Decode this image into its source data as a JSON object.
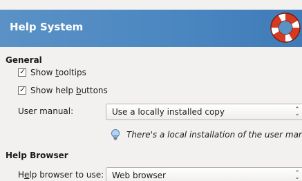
{
  "header": {
    "title": "Help System"
  },
  "general": {
    "heading": "General",
    "show_tooltips": {
      "label_pre": "Show ",
      "label_ul": "t",
      "label_post": "ooltips",
      "checked": true
    },
    "show_help_buttons": {
      "label_pre": "Show help ",
      "label_ul": "b",
      "label_post": "uttons",
      "checked": true
    },
    "user_manual": {
      "label": "User manual:",
      "value": "Use a locally installed copy",
      "info": "There's a local installation of the user manual."
    }
  },
  "help_browser": {
    "heading": "Help Browser",
    "browser_to_use": {
      "label_pre": "H",
      "label_ul": "e",
      "label_post": "lp browser to use:",
      "value": "Web browser"
    }
  },
  "colors": {
    "banner": "#4a86c0",
    "background": "#f2f1f0"
  },
  "icons": {
    "header": "lifebuoy-icon",
    "info": "lightbulb-icon"
  }
}
